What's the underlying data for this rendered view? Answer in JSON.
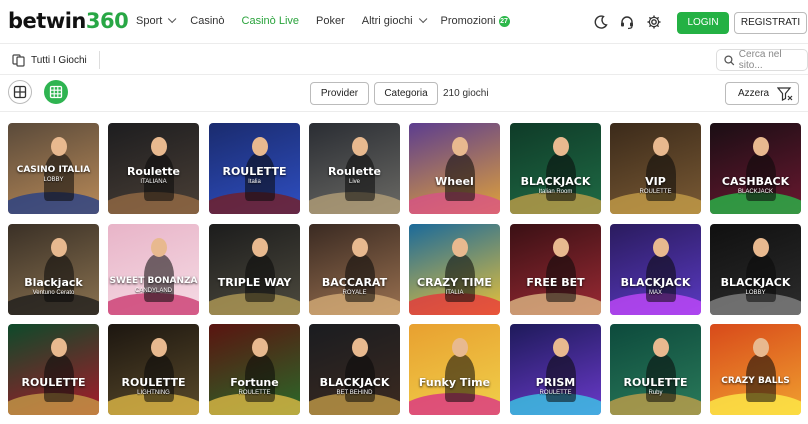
{
  "header": {
    "logo_text": "betwin",
    "logo_num": "360",
    "nav": [
      {
        "label": "Sport",
        "chevron": true
      },
      {
        "label": "Casinò",
        "chevron": false
      },
      {
        "label": "Casinò Live",
        "chevron": false,
        "active": true
      },
      {
        "label": "Poker",
        "chevron": false
      },
      {
        "label": "Altri giochi",
        "chevron": true
      },
      {
        "label": "Promozioni",
        "chevron": false,
        "badge": "27"
      }
    ],
    "login_label": "LOGIN",
    "register_label": "REGISTRATI",
    "icons": [
      "moon-icon",
      "headset-icon",
      "settings-icon"
    ]
  },
  "subbar": {
    "all_games_label": "Tutti I Giochi",
    "search_placeholder": "Cerca nel sito..."
  },
  "filters": {
    "provider_label": "Provider",
    "category_label": "Categoria",
    "count_label": "210 giochi",
    "reset_label": "Azzera"
  },
  "colors": {
    "accent": "#2db84b",
    "active_nav": "#2aa33c"
  },
  "games": [
    {
      "title": "CASINO ITALIA",
      "sub": "LOBBY",
      "bg": "#5a4a3a",
      "bg2": "#b98a58",
      "accent": "#1f3c8a"
    },
    {
      "title": "Roulette",
      "sub": "ITALIANA",
      "bg": "#1d1d1f",
      "bg2": "#4a3f36",
      "accent": "#9a6d45"
    },
    {
      "title": "ROULETTE",
      "sub": "Italia",
      "bg": "#1a2b6e",
      "bg2": "#2f4fc2",
      "accent": "#7a1c1c"
    },
    {
      "title": "Roulette",
      "sub": "Live",
      "bg": "#2a2d33",
      "bg2": "#6b6a65",
      "accent": "#b8a37a"
    },
    {
      "title": "Wheel",
      "sub": "",
      "bg": "#5c3d8f",
      "bg2": "#e0a23a",
      "accent": "#d94f8a"
    },
    {
      "title": "BLACKJACK",
      "sub": "Italian Room",
      "bg": "#0f3b28",
      "bg2": "#1f6b45",
      "accent": "#c9a24a"
    },
    {
      "title": "VIP",
      "sub": "ROULETTE",
      "bg": "#3b2a1a",
      "bg2": "#7a5a34",
      "accent": "#c9a24a"
    },
    {
      "title": "CASHBACK",
      "sub": "BLACKJACK",
      "bg": "#1a0e14",
      "bg2": "#6a1830",
      "accent": "#26c14b"
    },
    {
      "title": "Blackjack",
      "sub": "Ventuno Cerato",
      "bg": "#3a3026",
      "bg2": "#8a7250",
      "accent": "#1a1a1a"
    },
    {
      "title": "SWEET BONANZA",
      "sub": "CANDYLAND",
      "bg": "#e8b4c8",
      "bg2": "#f5dbe4",
      "accent": "#c8306a"
    },
    {
      "title": "TRIPLE WAY",
      "sub": "",
      "bg": "#1c1c1c",
      "bg2": "#4d4a3e",
      "accent": "#b8a058"
    },
    {
      "title": "BACCARAT",
      "sub": "ROYALE",
      "bg": "#3a2a22",
      "bg2": "#9a7150",
      "accent": "#d9b07a"
    },
    {
      "title": "CRAZY TIME",
      "sub": "ITALIA",
      "bg": "#1b6a9a",
      "bg2": "#e8c13a",
      "accent": "#e8303a"
    },
    {
      "title": "FREE BET",
      "sub": "",
      "bg": "#3a1014",
      "bg2": "#9a2a34",
      "accent": "#e3c08a"
    },
    {
      "title": "BLACKJACK",
      "sub": "MAX",
      "bg": "#2a1b5e",
      "bg2": "#5a3ac2",
      "accent": "#c84aff"
    },
    {
      "title": "BLACKJACK",
      "sub": "LOBBY",
      "bg": "#101010",
      "bg2": "#2c2c2c",
      "accent": "#888888"
    },
    {
      "title": "ROULETTE",
      "sub": "",
      "bg": "#0d4a2a",
      "bg2": "#a81a2a",
      "accent": "#c9a24a"
    },
    {
      "title": "ROULETTE",
      "sub": "LIGHTNING",
      "bg": "#1c1610",
      "bg2": "#5a4a2a",
      "accent": "#e8c048"
    },
    {
      "title": "Fortune",
      "sub": "ROULETTE",
      "bg": "#5a1410",
      "bg2": "#2a6a2a",
      "accent": "#e8c048"
    },
    {
      "title": "BLACKJACK",
      "sub": "BET BEHIND",
      "bg": "#1a1c20",
      "bg2": "#3c2a20",
      "accent": "#c9a24a"
    },
    {
      "title": "Funky Time",
      "sub": "",
      "bg": "#e8a030",
      "bg2": "#f0d04a",
      "accent": "#d82a8a"
    },
    {
      "title": "PRISM",
      "sub": "ROULETTE",
      "bg": "#1e1a5a",
      "bg2": "#6a3aca",
      "accent": "#3ad0e8"
    },
    {
      "title": "ROULETTE",
      "sub": "Ruby",
      "bg": "#0d4a3c",
      "bg2": "#2a7a5a",
      "accent": "#c9a24a"
    },
    {
      "title": "CRAZY BALLS",
      "sub": "",
      "bg": "#d84a1a",
      "bg2": "#f0a030",
      "accent": "#fff04a"
    }
  ]
}
